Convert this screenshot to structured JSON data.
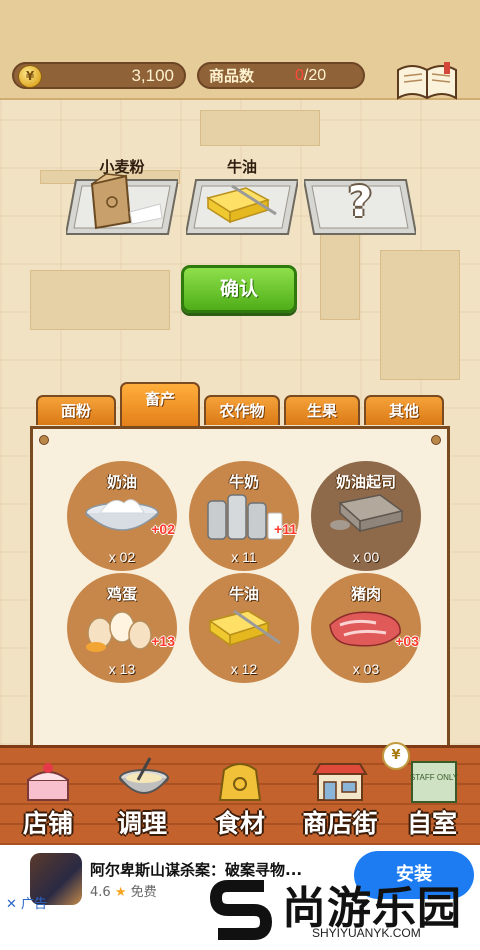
{
  "header": {
    "coin_symbol": "¥",
    "coins": "3,100",
    "goods_label": "商品数",
    "goods_current": "0",
    "goods_max": "/20",
    "recipe_label": "食谱"
  },
  "recipe_slots": [
    {
      "label": "小麦粉",
      "icon": "flour-bag-icon"
    },
    {
      "label": "牛油",
      "icon": "butter-icon"
    },
    {
      "label": "",
      "icon": "question-mark-icon",
      "symbol": "?"
    }
  ],
  "confirm_label": "确认",
  "tabs": [
    {
      "label": "面粉",
      "active": false
    },
    {
      "label": "畜产",
      "active": true
    },
    {
      "label": "农作物",
      "active": false
    },
    {
      "label": "生果",
      "active": false
    },
    {
      "label": "其他",
      "active": false
    }
  ],
  "inventory": [
    {
      "name": "奶油",
      "count": "x 02",
      "plus": "+02",
      "icon": "cream-bowl-icon"
    },
    {
      "name": "牛奶",
      "count": "x 11",
      "plus": "+11",
      "icon": "milk-bottles-icon"
    },
    {
      "name": "奶油起司",
      "count": "x 00",
      "plus": "",
      "icon": "cream-cheese-icon"
    },
    {
      "name": "鸡蛋",
      "count": "x 13",
      "plus": "+13",
      "icon": "eggs-icon"
    },
    {
      "name": "牛油",
      "count": "x 12",
      "plus": "",
      "icon": "butter-icon"
    },
    {
      "name": "猪肉",
      "count": "x 03",
      "plus": "+03",
      "icon": "pork-icon"
    }
  ],
  "bottom_nav": [
    {
      "label": "店铺",
      "icon": "cake-icon"
    },
    {
      "label": "调理",
      "icon": "mixing-bowl-icon"
    },
    {
      "label": "食材",
      "icon": "ingredient-bag-icon"
    },
    {
      "label": "商店街",
      "icon": "shop-street-icon"
    },
    {
      "label": "自室",
      "icon": "staff-only-door-icon"
    }
  ],
  "nav_coin_symbol": "¥",
  "staff_sign": "STAFF ONLY",
  "ad": {
    "title": "阿尔卑斯山谋杀案：破案寻物...",
    "rating": "4.6",
    "price": "免费",
    "install": "安装",
    "close_label": "✕ 广告"
  },
  "watermark": {
    "main": "尚游乐园",
    "sub": "SHYIYUANYK.COM"
  },
  "colors": {
    "confirm_green": "#4fae18",
    "tab_orange": "#e4801a",
    "plus_red": "#ff3a2c",
    "install_blue": "#1d7cf2"
  }
}
